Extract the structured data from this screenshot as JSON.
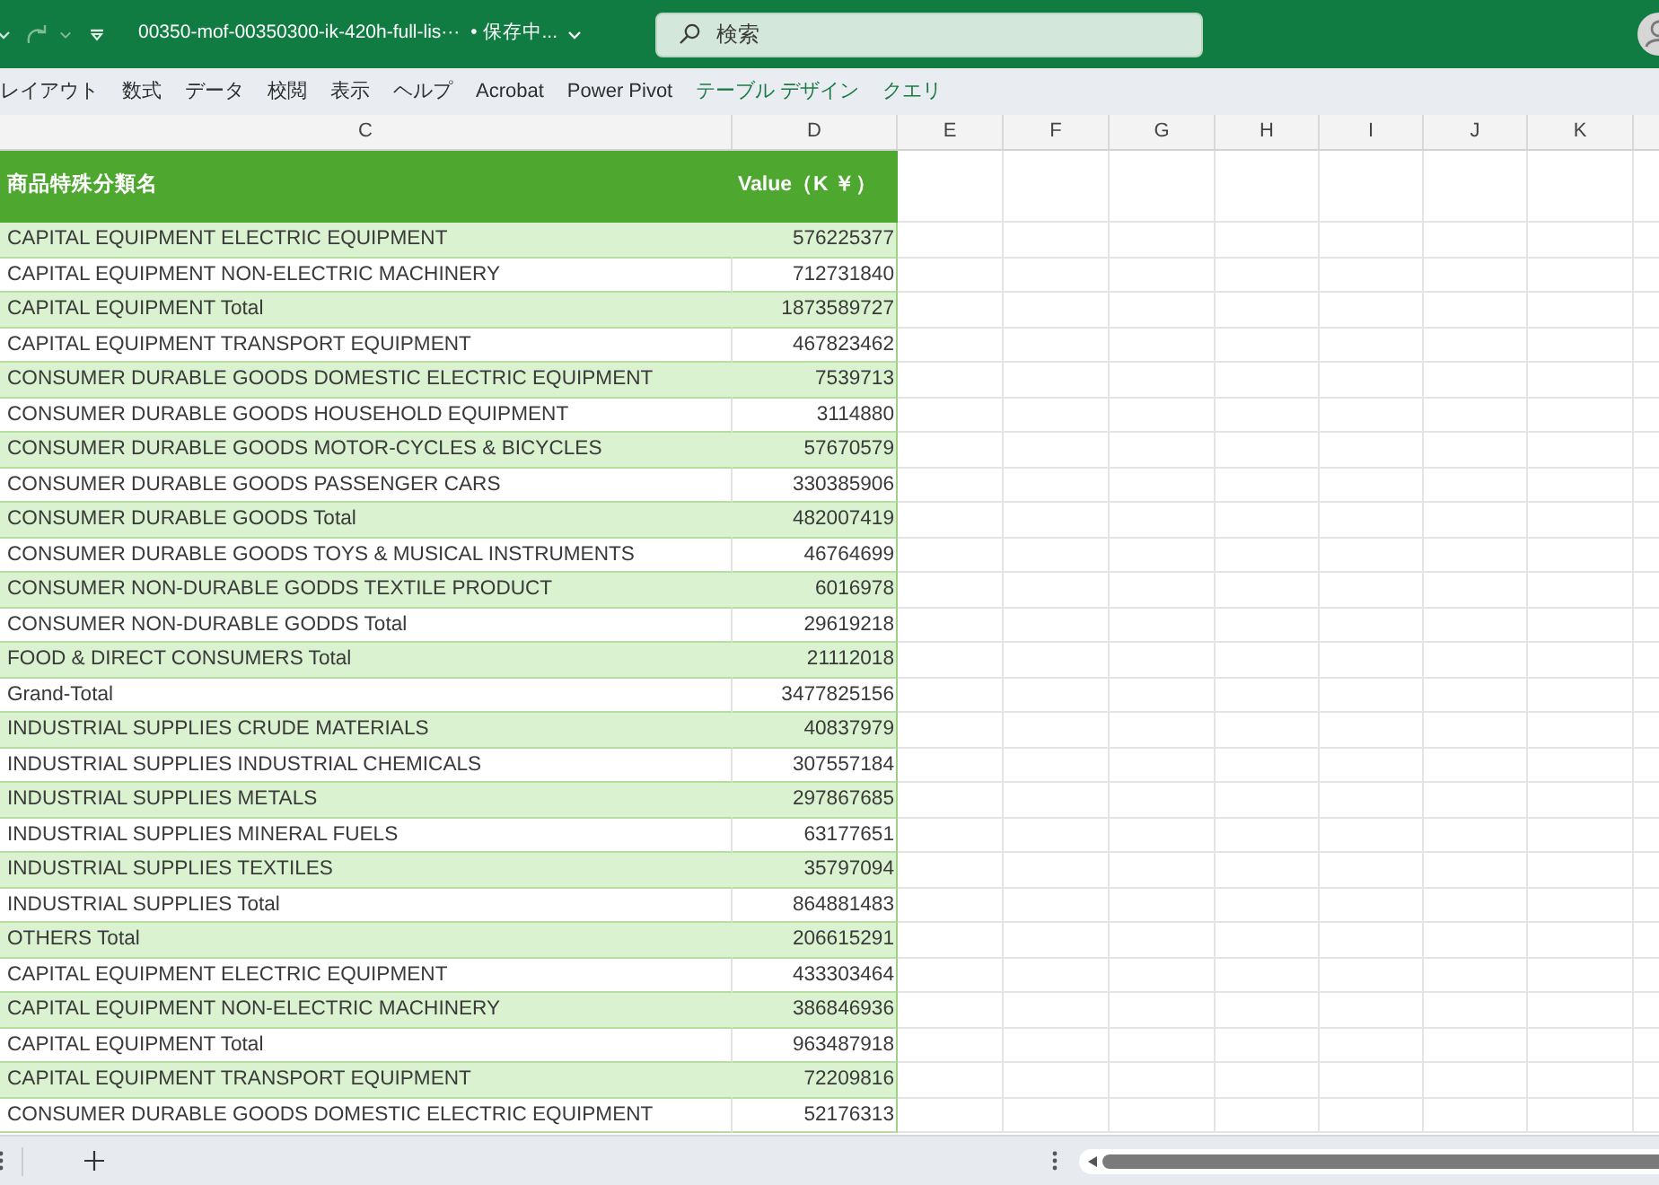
{
  "title_bar": {
    "file_name": "00350-mof-00350300-ik-420h-full-lis···",
    "save_status": "• 保存中...",
    "search": {
      "placeholder": "検索"
    }
  },
  "ribbon_tabs": [
    {
      "label": "レイアウト",
      "kind": "standard"
    },
    {
      "label": "数式",
      "kind": "standard"
    },
    {
      "label": "データ",
      "kind": "standard"
    },
    {
      "label": "校閲",
      "kind": "standard"
    },
    {
      "label": "表示",
      "kind": "standard"
    },
    {
      "label": "ヘルプ",
      "kind": "standard"
    },
    {
      "label": "Acrobat",
      "kind": "standard"
    },
    {
      "label": "Power Pivot",
      "kind": "standard"
    },
    {
      "label": "テーブル デザイン",
      "kind": "contextual"
    },
    {
      "label": "クエリ",
      "kind": "contextual"
    }
  ],
  "column_headers": [
    "C",
    "D",
    "E",
    "F",
    "G",
    "H",
    "I",
    "J",
    "K"
  ],
  "table": {
    "columns": [
      "商品特殊分類名",
      "Value（K ￥）"
    ],
    "rows": [
      {
        "name": "CAPITAL EQUIPMENT ELECTRIC EQUIPMENT",
        "value": "576225377"
      },
      {
        "name": "CAPITAL EQUIPMENT NON-ELECTRIC MACHINERY",
        "value": "712731840"
      },
      {
        "name": "CAPITAL EQUIPMENT Total",
        "value": "1873589727"
      },
      {
        "name": "CAPITAL EQUIPMENT TRANSPORT EQUIPMENT",
        "value": "467823462"
      },
      {
        "name": "CONSUMER DURABLE GOODS DOMESTIC ELECTRIC EQUIPMENT",
        "value": "7539713"
      },
      {
        "name": "CONSUMER DURABLE GOODS HOUSEHOLD EQUIPMENT",
        "value": "3114880"
      },
      {
        "name": "CONSUMER DURABLE GOODS MOTOR-CYCLES & BICYCLES",
        "value": "57670579"
      },
      {
        "name": "CONSUMER DURABLE GOODS PASSENGER CARS",
        "value": "330385906"
      },
      {
        "name": "CONSUMER DURABLE GOODS Total",
        "value": "482007419"
      },
      {
        "name": "CONSUMER DURABLE GOODS TOYS & MUSICAL INSTRUMENTS",
        "value": "46764699"
      },
      {
        "name": "CONSUMER NON-DURABLE GODDS TEXTILE PRODUCT",
        "value": "6016978"
      },
      {
        "name": "CONSUMER NON-DURABLE GODDS Total",
        "value": "29619218"
      },
      {
        "name": "FOOD & DIRECT CONSUMERS Total",
        "value": "21112018"
      },
      {
        "name": "Grand-Total",
        "value": "3477825156"
      },
      {
        "name": "INDUSTRIAL SUPPLIES CRUDE MATERIALS",
        "value": "40837979"
      },
      {
        "name": "INDUSTRIAL SUPPLIES INDUSTRIAL CHEMICALS",
        "value": "307557184"
      },
      {
        "name": "INDUSTRIAL SUPPLIES METALS",
        "value": "297867685"
      },
      {
        "name": "INDUSTRIAL SUPPLIES MINERAL FUELS",
        "value": "63177651"
      },
      {
        "name": "INDUSTRIAL SUPPLIES TEXTILES",
        "value": "35797094"
      },
      {
        "name": "INDUSTRIAL SUPPLIES Total",
        "value": "864881483"
      },
      {
        "name": "OTHERS Total",
        "value": "206615291"
      },
      {
        "name": "CAPITAL EQUIPMENT ELECTRIC EQUIPMENT",
        "value": "433303464"
      },
      {
        "name": "CAPITAL EQUIPMENT NON-ELECTRIC MACHINERY",
        "value": "386846936"
      },
      {
        "name": "CAPITAL EQUIPMENT Total",
        "value": "963487918"
      },
      {
        "name": "CAPITAL EQUIPMENT TRANSPORT EQUIPMENT",
        "value": "72209816"
      },
      {
        "name": "CONSUMER DURABLE GOODS DOMESTIC ELECTRIC EQUIPMENT",
        "value": "52176313"
      }
    ]
  }
}
